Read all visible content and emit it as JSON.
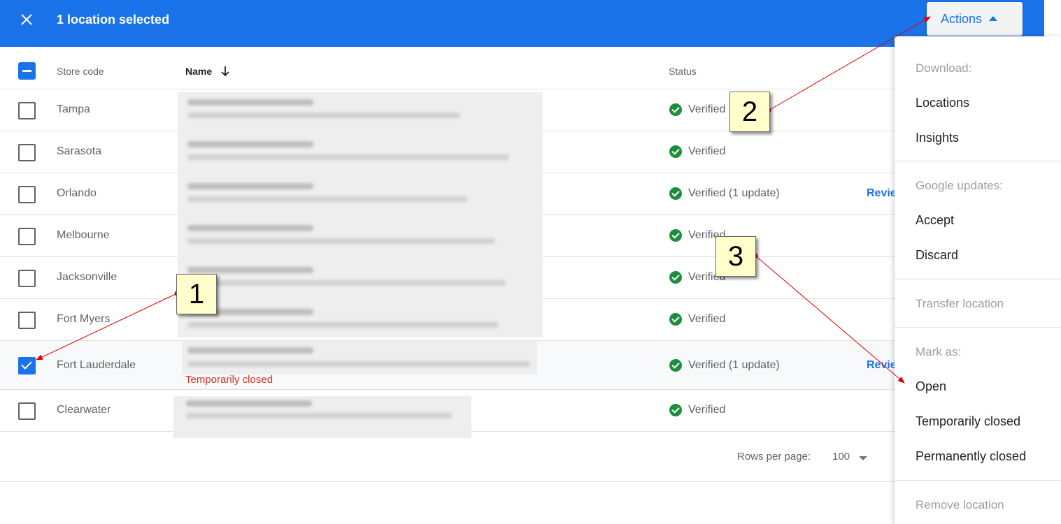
{
  "topbar": {
    "title": "1 location selected",
    "actions_label": "Actions"
  },
  "table": {
    "headers": {
      "store_code": "Store code",
      "name": "Name",
      "status": "Status"
    },
    "rows": [
      {
        "store_code": "Tampa",
        "status": "Verified",
        "selected": false,
        "review": ""
      },
      {
        "store_code": "Sarasota",
        "status": "Verified",
        "selected": false,
        "review": ""
      },
      {
        "store_code": "Orlando",
        "status": "Verified (1 update)",
        "selected": false,
        "review": "Review"
      },
      {
        "store_code": "Melbourne",
        "status": "Verified",
        "selected": false,
        "review": ""
      },
      {
        "store_code": "Jacksonville",
        "status": "Verified",
        "selected": false,
        "review": ""
      },
      {
        "store_code": "Fort Myers",
        "status": "Verified",
        "selected": false,
        "review": ""
      },
      {
        "store_code": "Fort Lauderdale",
        "status": "Verified (1 update)",
        "selected": true,
        "review": "Review",
        "note": "Temporarily closed"
      },
      {
        "store_code": "Clearwater",
        "status": "Verified",
        "selected": false,
        "review": ""
      }
    ]
  },
  "footer": {
    "rows_per_page_label": "Rows per page:",
    "rows_per_page_value": "100"
  },
  "menu": {
    "download_header": "Download:",
    "locations": "Locations",
    "insights": "Insights",
    "google_updates_header": "Google updates:",
    "accept": "Accept",
    "discard": "Discard",
    "transfer_location": "Transfer location",
    "mark_as_header": "Mark as:",
    "open": "Open",
    "temporarily_closed": "Temporarily closed",
    "permanently_closed": "Permanently closed",
    "remove_location": "Remove location"
  },
  "callouts": {
    "c1": "1",
    "c2": "2",
    "c3": "3"
  },
  "colors": {
    "primary": "#1a73e8",
    "verified_green": "#1e8e3e",
    "closed_red": "#d93025",
    "callout_fill": "#ffffcc",
    "arrow_red": "#e00000"
  }
}
